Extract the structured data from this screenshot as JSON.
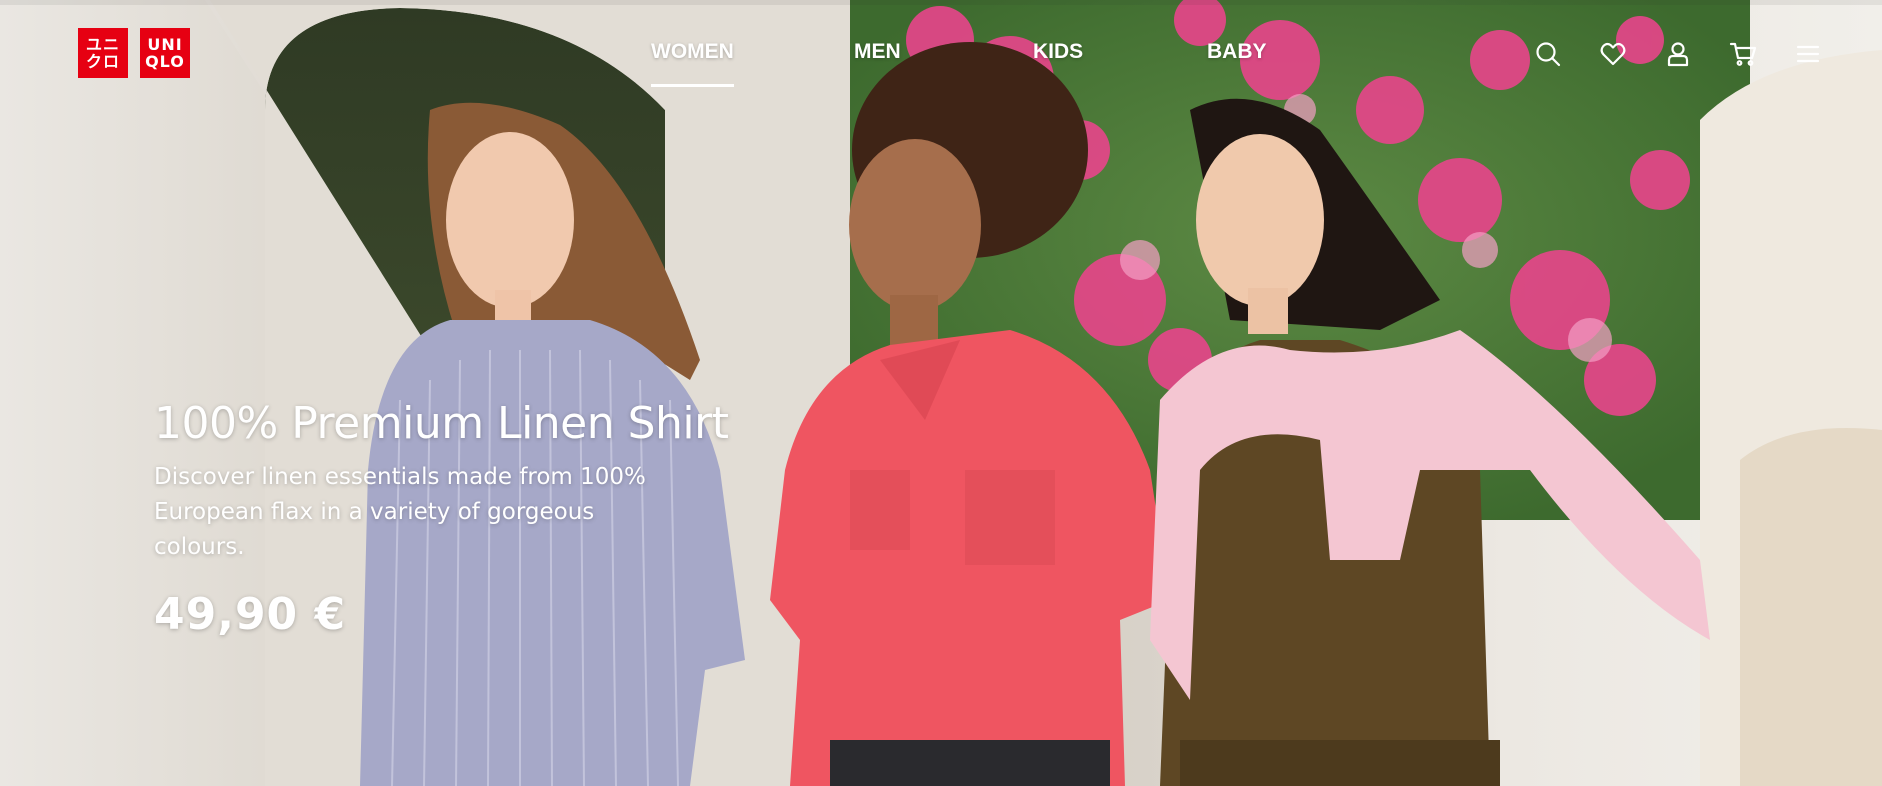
{
  "brand": {
    "logo_line_1": "ユニ",
    "logo_line_2": "クロ",
    "logo_line_3": "UNI",
    "logo_line_4": "QLO"
  },
  "nav": {
    "items": [
      {
        "label": "WOMEN",
        "active": true
      },
      {
        "label": "MEN",
        "active": false
      },
      {
        "label": "KIDS",
        "active": false
      },
      {
        "label": "BABY",
        "active": false
      }
    ],
    "icons": [
      "search-icon",
      "heart-icon",
      "user-icon",
      "cart-icon",
      "menu-icon"
    ]
  },
  "hero": {
    "title": "100% Premium Linen Shirt",
    "description": "Discover linen essentials made from 100% European flax in a variety of gorgeous colours.",
    "price": "49,90 €"
  },
  "colors": {
    "brand_red": "#e60012",
    "white": "#ffffff",
    "shirt_coral": "#ef5561",
    "shirt_lavender": "#a6a8c8",
    "top_brown": "#5e4724",
    "sweater_pink": "#f4c6d2",
    "flower_pink": "#e8458b",
    "foliage_green": "#4f7a3a"
  }
}
